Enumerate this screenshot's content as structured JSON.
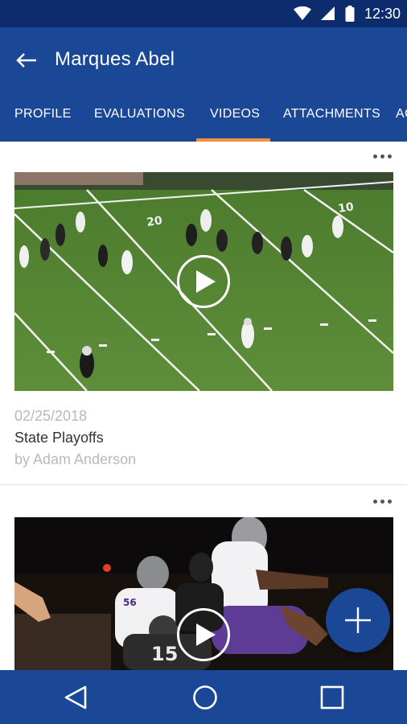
{
  "status_bar": {
    "time": "12:30",
    "icons": [
      "wifi-icon",
      "signal-icon",
      "battery-icon"
    ]
  },
  "app_bar": {
    "title": "Marques Abel",
    "back_icon": "arrow-left-icon"
  },
  "tabs": [
    {
      "label": "PROFILE",
      "active": false
    },
    {
      "label": "EVALUATIONS",
      "active": false
    },
    {
      "label": "VIDEOS",
      "active": true
    },
    {
      "label": "ATTACHMENTS",
      "active": false
    },
    {
      "label": "AC",
      "active": false
    }
  ],
  "videos": [
    {
      "date": "02/25/2018",
      "title": "State Playoffs",
      "author": "by Adam Anderson",
      "menu_icon": "more-horizontal-icon",
      "play_icon": "play-icon",
      "field_markings": [
        "20",
        "10"
      ]
    },
    {
      "menu_icon": "more-horizontal-icon",
      "play_icon": "play-icon",
      "jersey_numbers": [
        "56",
        "15"
      ]
    }
  ],
  "fab": {
    "icon": "plus-icon"
  },
  "nav": {
    "back_icon": "triangle-back-icon",
    "home_icon": "circle-home-icon",
    "recents_icon": "square-recents-icon"
  },
  "colors": {
    "status_bar": "#0d2c6e",
    "primary": "#1a4896",
    "tab_indicator": "#f2913d",
    "secondary_text": "#b9b9b9"
  }
}
